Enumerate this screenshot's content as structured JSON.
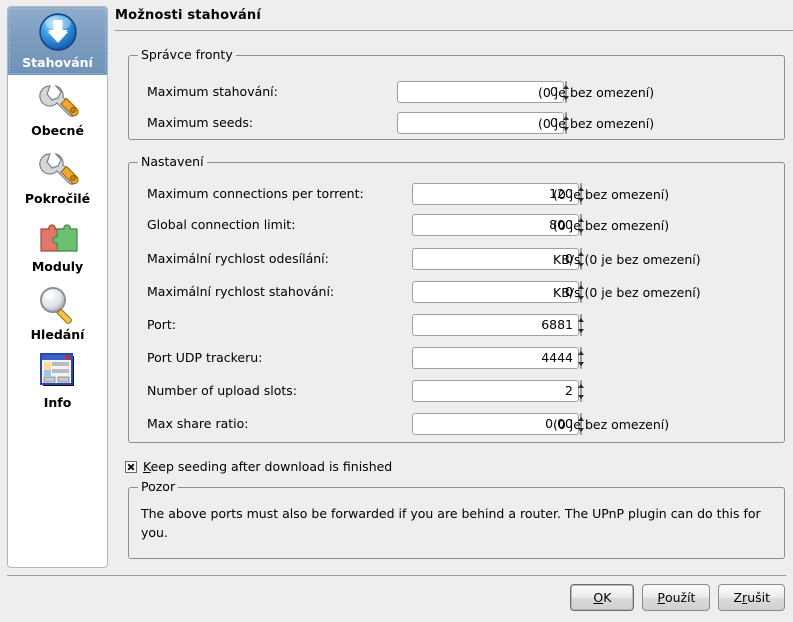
{
  "window": {
    "title": "Možnosti stahování"
  },
  "sidebar": {
    "items": [
      {
        "label": "Stahování",
        "icon": "download-icon",
        "selected": true
      },
      {
        "label": "Obecné",
        "icon": "wrench-icon",
        "selected": false
      },
      {
        "label": "Pokročilé",
        "icon": "wrench-icon",
        "selected": false
      },
      {
        "label": "Moduly",
        "icon": "puzzle-icon",
        "selected": false
      },
      {
        "label": "Hledání",
        "icon": "magnifier-icon",
        "selected": false
      },
      {
        "label": "Info",
        "icon": "window-info-icon",
        "selected": false
      }
    ]
  },
  "queue_group": {
    "title": "Správce fronty",
    "rows": [
      {
        "label": "Maximum stahování:",
        "value": "0",
        "hint": "(0 je bez omezení)"
      },
      {
        "label": "Maximum seeds:",
        "value": "0",
        "hint": "(0 je bez omezení)"
      }
    ]
  },
  "settings_group": {
    "title": "Nastavení",
    "rows": [
      {
        "label": "Maximum connections per torrent:",
        "value": "120",
        "hint": "(0 je bez omezení)"
      },
      {
        "label": "Global connection limit:",
        "value": "800",
        "hint": "(0 je bez omezení)"
      },
      {
        "label": "Maximální rychlost odesílání:",
        "value": "0",
        "hint": "KB/s (0 je bez omezení)"
      },
      {
        "label": "Maximální rychlost stahování:",
        "value": "0",
        "hint": "KB/s (0 je bez omezení)"
      },
      {
        "label": "Port:",
        "value": "6881",
        "hint": ""
      },
      {
        "label": "Port UDP trackeru:",
        "value": "4444",
        "hint": ""
      },
      {
        "label": "Number of upload slots:",
        "value": "2",
        "hint": ""
      },
      {
        "label": "Max share ratio:",
        "value": "0.00",
        "hint": "(0 je bez omezení)"
      }
    ]
  },
  "keep_seeding": {
    "label_mnemonic": "K",
    "label_rest": "eep seeding after download is finished",
    "checked": true
  },
  "notice_group": {
    "title": "Pozor",
    "text": "The above ports must also be forwarded if you are behind a router. The UPnP plugin can do this for you."
  },
  "buttons": [
    {
      "mnemonic": "O",
      "rest": "K",
      "default": true
    },
    {
      "pre": "",
      "mnemonic": "P",
      "rest": "oužít",
      "default": false
    },
    {
      "pre": "Z",
      "mnemonic": "r",
      "rest": "ušit",
      "default": false
    }
  ],
  "colors": {
    "background": "#eeeeee",
    "selection": "#7b9cbe",
    "group_border": "#8d8d8d"
  }
}
